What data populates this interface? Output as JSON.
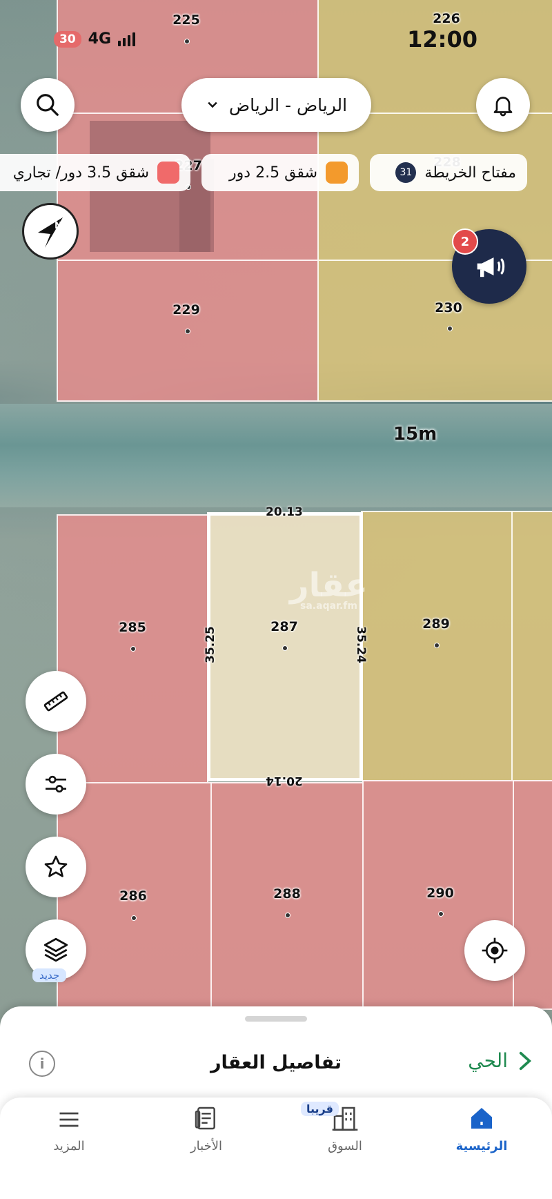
{
  "status_bar": {
    "battery": "30",
    "network": "4G",
    "time": "12:00"
  },
  "top": {
    "city_label": "الرياض - الرياض",
    "map_key_label": "مفتاح الخريطة",
    "map_key_count": "31",
    "legend": [
      {
        "label": "شقق 2.5 دور",
        "color": "#f39a2c"
      },
      {
        "label": "شقق 3.5 دور/ تجاري",
        "color": "#f06a6a"
      }
    ]
  },
  "promo_badge": "2",
  "map": {
    "road_label": "15m",
    "watermark": "عقار",
    "watermark_sub": "sa.aqar.fm",
    "plots": [
      "225",
      "226",
      "227",
      "228",
      "229",
      "230",
      "285",
      "286",
      "287",
      "288",
      "289",
      "290"
    ],
    "dims": {
      "top": "20.13",
      "bottom": "20.14",
      "left": "35.25",
      "right": "35.24"
    }
  },
  "tools": {
    "new_label": "جديد"
  },
  "sheet": {
    "title": "تفاصيل العقار",
    "link": "الحي"
  },
  "tabs": [
    {
      "label": "الرئيسية",
      "icon": "home-icon",
      "active": true
    },
    {
      "label": "السوق",
      "icon": "building-icon",
      "tag": "قريبا"
    },
    {
      "label": "الأخبار",
      "icon": "news-icon"
    },
    {
      "label": "المزيد",
      "icon": "menu-icon"
    }
  ],
  "colors": {
    "accent": "#1a63c9",
    "link_green": "#1f8a50",
    "red_parcel": "#e88c8c",
    "yellow_parcel": "#dec478"
  }
}
